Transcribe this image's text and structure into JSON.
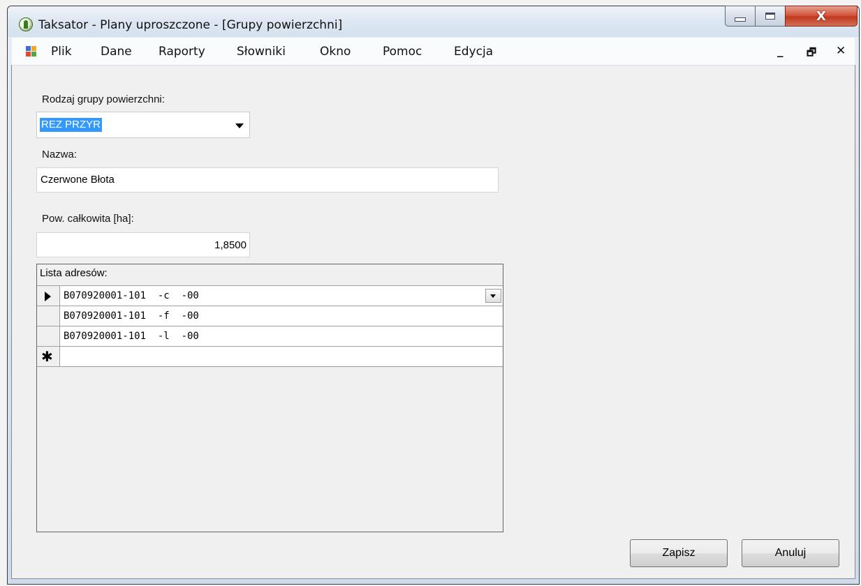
{
  "window": {
    "title": "Taksator - Plany uproszczone - [Grupy powierzchni]",
    "icon": "tree-app-icon"
  },
  "menu": {
    "items": [
      "Plik",
      "Dane",
      "Raporty",
      "Słowniki",
      "Okno",
      "Pomoc",
      "Edycja"
    ],
    "mdi_controls": {
      "minimize": "_",
      "restore": "🗗",
      "close": "✕"
    }
  },
  "form": {
    "group_type": {
      "label": "Rodzaj grupy powierzchni:",
      "value": "REZ PRZYR"
    },
    "name": {
      "label": "Nazwa:",
      "value": "Czerwone Błota"
    },
    "area": {
      "label": "Pow. całkowita [ha]:",
      "value": "1,8500"
    },
    "addresses": {
      "caption": "Lista adresów:",
      "rows": [
        "B070920001-101  -c  -00",
        "B070920001-101  -f  -00",
        "B070920001-101  -l  -00"
      ],
      "new_row_marker": "✱"
    }
  },
  "buttons": {
    "save": "Zapisz",
    "cancel": "Anuluj"
  },
  "colors": {
    "selection": "#3399ff",
    "close_button": "#c0391e"
  }
}
